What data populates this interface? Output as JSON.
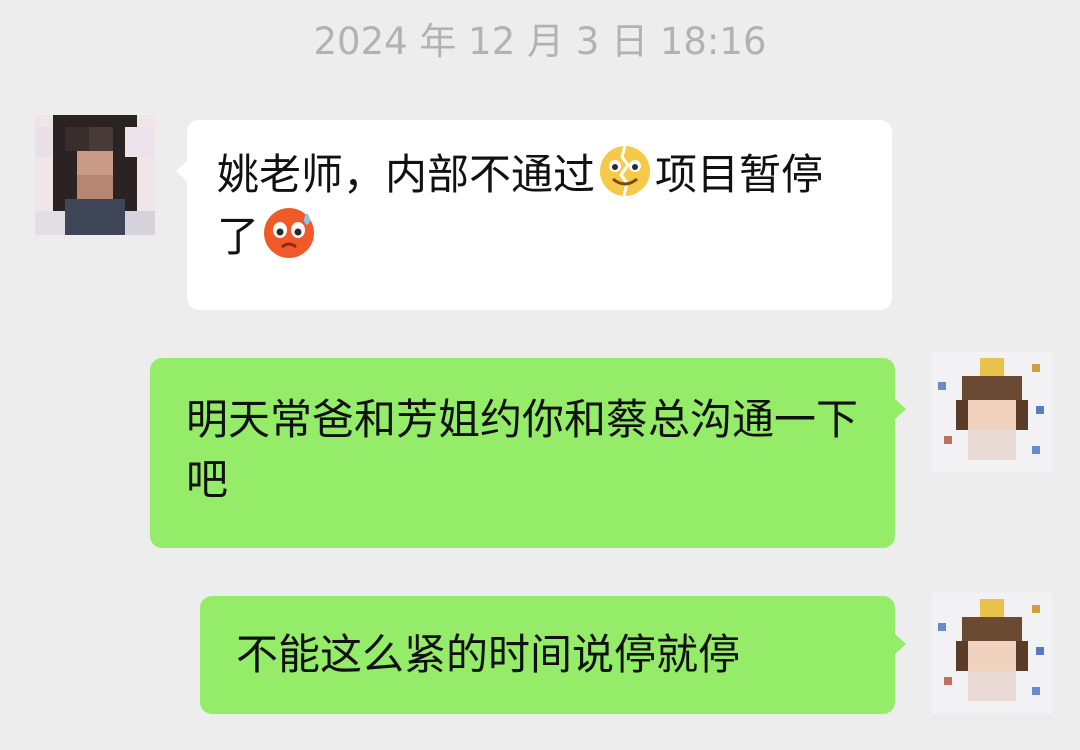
{
  "chat": {
    "timestamp": "2024 年 12 月 3 日 18:16",
    "messages": [
      {
        "sender": "incoming",
        "text_part1": "姚老师，内部不通过",
        "emoji1": "broken-smile-emoji",
        "text_part2": "项目暂停了",
        "emoji2": "sweating-face-emoji"
      },
      {
        "sender": "outgoing",
        "text": "明天常爸和芳姐约你和蔡总沟通一下吧"
      },
      {
        "sender": "outgoing",
        "text": "不能这么紧的时间说停就停"
      }
    ]
  },
  "colors": {
    "background": "#ededed",
    "incoming_bubble": "#ffffff",
    "outgoing_bubble": "#95ec69",
    "timestamp_text": "#b2b2b2"
  }
}
